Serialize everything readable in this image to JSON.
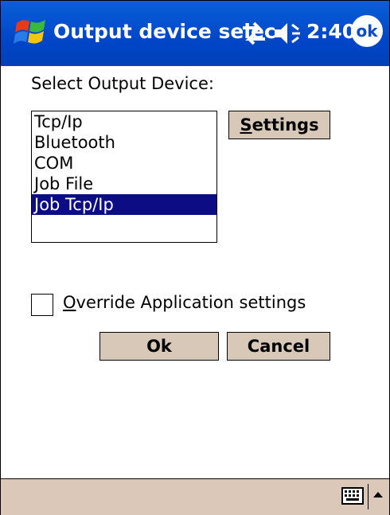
{
  "title_bar": {
    "title": "Output device selec",
    "clock": "2:40",
    "ok_label": "ok",
    "icons": [
      "windows-start-icon",
      "connectivity-icon",
      "volume-icon"
    ]
  },
  "dialog": {
    "select_label": "Select Output Device:",
    "devices": [
      "Tcp/Ip",
      "Bluetooth",
      "COM",
      "Job File",
      "Job Tcp/Ip"
    ],
    "selected_device": "Job Tcp/Ip",
    "settings_button": {
      "mnemonic": "S",
      "rest": "ettings"
    },
    "override_checkbox": {
      "mnemonic": "O",
      "rest": "verride Application settings",
      "checked": false
    },
    "ok_button": "Ok",
    "cancel_button": "Cancel"
  },
  "colors": {
    "title_bar": "#0046c8",
    "selection": "#0c0c84",
    "button_face": "#d8c8b8",
    "menu_bar": "#dcc8b8"
  },
  "bottom_bar": {
    "icons": [
      "keyboard-icon",
      "sip-arrow-icon"
    ]
  }
}
